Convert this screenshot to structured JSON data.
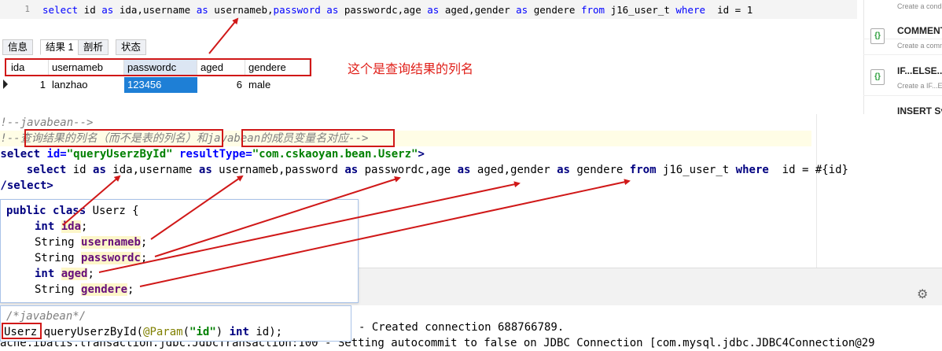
{
  "sql_editor": {
    "line_number": "1",
    "s1": "select",
    "s2": " id ",
    "s3": "as",
    "s4": " ida,username ",
    "s5": "as",
    "s6": " usernameb,",
    "s7": "password",
    "s8": " ",
    "s9": "as",
    "s10": " passwordc,age ",
    "s11": "as",
    "s12": " aged,gender ",
    "s13": "as",
    "s14": " gendere ",
    "s15": "from",
    "s16": " j16_user_t ",
    "s17": "where",
    "s18": "  id = 1"
  },
  "result_tabs": [
    "信息",
    "结果 1",
    "剖析",
    "状态"
  ],
  "grid": {
    "columns": [
      "ida",
      "usernameb",
      "passwordc",
      "aged",
      "gendere"
    ],
    "row": [
      "1",
      "lanzhao",
      "123456",
      "6",
      "male"
    ]
  },
  "annotation_columns": "这个是查询结果的列名",
  "code": {
    "l1": "<!--javabean-->",
    "l2a": "<!--",
    "l2b": "查询结果的列名（而不是表的列名）",
    "l2c": "和",
    "l2d": "javabean的成员变量名对应",
    "l2e": "-->",
    "l3a": "<select",
    "l3b": " id=",
    "l3c": "\"queryUserzById\"",
    "l3d": " resultType=",
    "l3e": "\"com.cskaoyan.bean.Userz\"",
    "l3f": ">",
    "l4a": "    select",
    "l4b": " id ",
    "l4c": "as",
    "l4d": " ida,username ",
    "l4e": "as",
    "l4f": " usernameb,password ",
    "l4g": "as",
    "l4h": " passwordc,age ",
    "l4i": "as",
    "l4j": " aged,gender ",
    "l4k": "as",
    "l4l": " gendere ",
    "l4m": "from",
    "l4n": " j16_user_t ",
    "l4o": "where",
    "l4p": "  id = #{id}",
    "l5": "</select>"
  },
  "java": {
    "j1a": "public",
    "j1b": "class",
    "j1c": " Userz {",
    "f1t": "int",
    "f1n": "ida",
    "f2t": "String",
    "f2n": "usernameb",
    "f3t": "String",
    "f3n": "passwordc",
    "f4t": "int",
    "f4n": "aged",
    "f5t": "String",
    "f5n": "gendere",
    "semi": ";"
  },
  "iface": {
    "comment": "/*javabean*/",
    "ret": "Userz",
    "method": " queryUserzById(",
    "ann": "@Param",
    "open": "(",
    "arg": "\"id\"",
    "close": ") ",
    "int": "int",
    "rest": " id);"
  },
  "console": {
    "line1": "- Created connection 688766789.",
    "line2": "ache.ibatis.transaction.jdbc.JdbcTransaction:100 - Setting autocommit to false on JDBC Connection [com.mysql.jdbc.JDBC4Connection@29"
  },
  "right_panel": [
    {
      "title": "",
      "sub": "Create a condition"
    },
    {
      "title": "COMMENT",
      "sub": "Create a comm"
    },
    {
      "title": "IF...ELSE...",
      "sub": "Create a IF...ELSE"
    },
    {
      "title": "INSERT Sy",
      "sub": ""
    }
  ],
  "colors": {
    "highlight": "#d01818",
    "selected_cell": "#1e7fd6"
  }
}
